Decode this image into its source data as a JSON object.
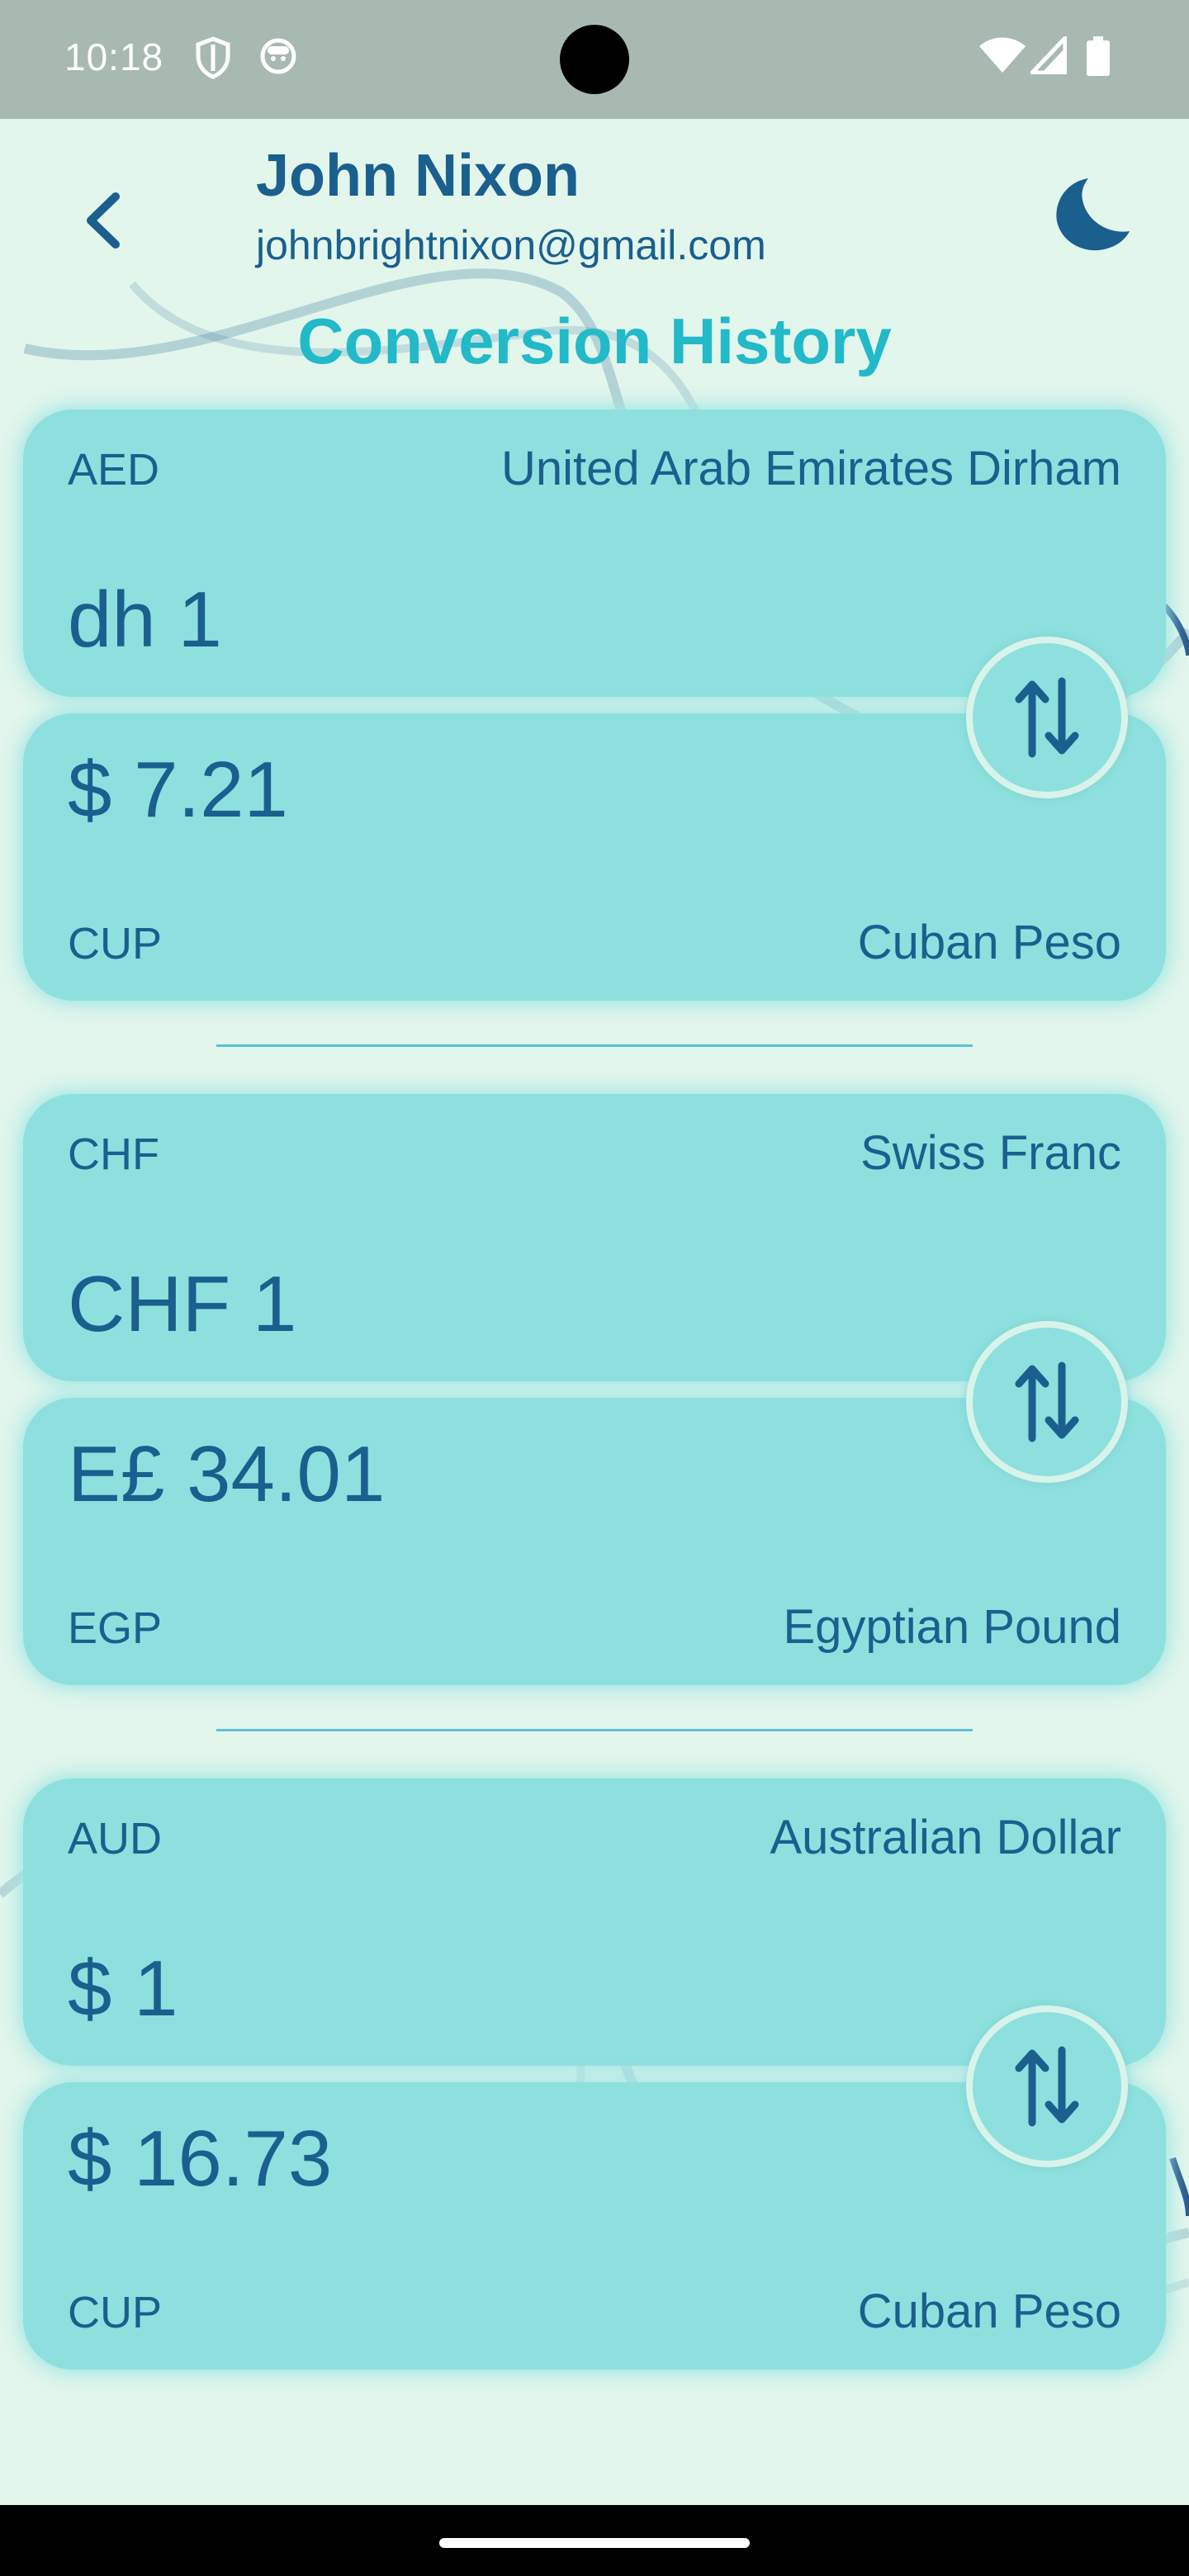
{
  "status_bar": {
    "time": "10:18",
    "icons": [
      "shield-icon",
      "face-icon",
      "wifi-icon",
      "signal-icon",
      "battery-icon"
    ]
  },
  "header": {
    "name": "John Nixon",
    "email": "johnbrightnixon@gmail.com",
    "back_icon": "chevron-left-icon",
    "theme_icon": "moon-icon"
  },
  "title": "Conversion History",
  "colors": {
    "background": "#e2f6ec",
    "card": "#8de0de",
    "text": "#1a5f8e",
    "title": "#22b9c9",
    "status_bar": "#a8b9b1"
  },
  "conversions": [
    {
      "from": {
        "code": "AED",
        "name": "United Arab Emirates Dirham",
        "amount": "dh 1"
      },
      "to": {
        "code": "CUP",
        "name": "Cuban Peso",
        "amount": "$ 7.21"
      }
    },
    {
      "from": {
        "code": "CHF",
        "name": "Swiss Franc",
        "amount": "CHF 1"
      },
      "to": {
        "code": "EGP",
        "name": "Egyptian Pound",
        "amount": "E£ 34.01"
      }
    },
    {
      "from": {
        "code": "AUD",
        "name": "Australian Dollar",
        "amount": "$ 1"
      },
      "to": {
        "code": "CUP",
        "name": "Cuban Peso",
        "amount": "$ 16.73"
      }
    }
  ]
}
